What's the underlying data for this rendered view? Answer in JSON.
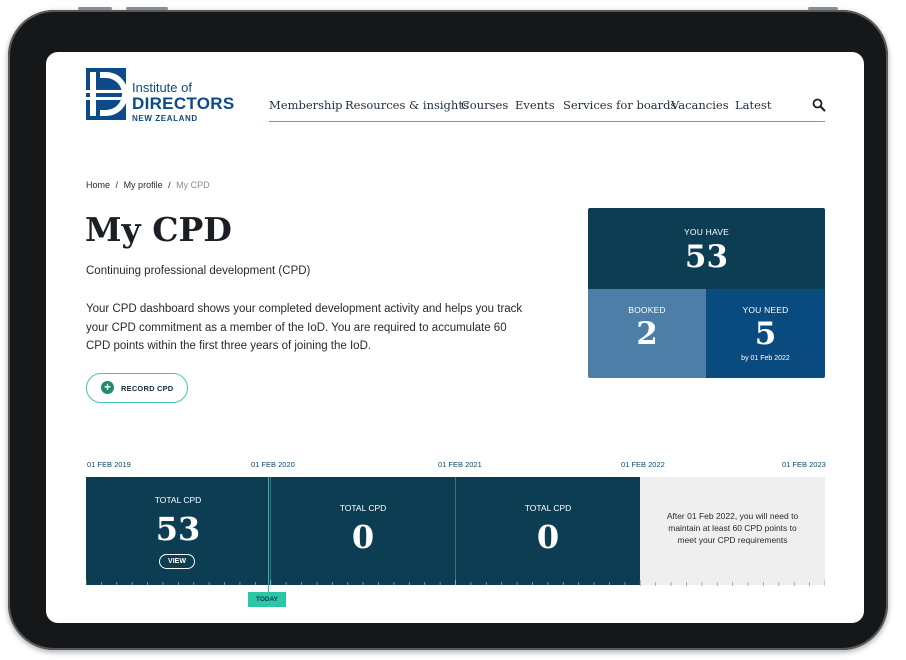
{
  "logo": {
    "line1": "Institute of",
    "line2": "DIRECTORS",
    "line3": "NEW ZEALAND"
  },
  "nav": {
    "items": [
      {
        "label": "Membership"
      },
      {
        "label": "Resources & insights"
      },
      {
        "label": "Courses"
      },
      {
        "label": "Events"
      },
      {
        "label": "Services for boards"
      },
      {
        "label": "Vacancies"
      },
      {
        "label": "Latest"
      }
    ],
    "search_icon": "search-icon"
  },
  "breadcrumb": {
    "items": [
      "Home",
      "My profile",
      "My CPD"
    ],
    "separator": "/"
  },
  "page": {
    "title": "My CPD",
    "subtitle": "Continuing professional development (CPD)",
    "description": "Your CPD dashboard shows your completed development activity and helps you track your CPD commitment as a member of the IoD. You are required to accumulate 60 CPD points within the first three years of joining the IoD.",
    "record_button": "RECORD CPD"
  },
  "stats": {
    "have_label": "YOU HAVE",
    "have_value": "53",
    "booked_label": "BOOKED",
    "booked_value": "2",
    "need_label": "YOU NEED",
    "need_value": "5",
    "need_note": "by 01 Feb 2022"
  },
  "timeline": {
    "dates": [
      "01 FEB 2019",
      "01 FEB 2020",
      "01 FEB 2021",
      "01 FEB 2022",
      "01 FEB 2023"
    ],
    "years": [
      {
        "label": "TOTAL CPD",
        "value": "53",
        "view": "VIEW"
      },
      {
        "label": "TOTAL CPD",
        "value": "0"
      },
      {
        "label": "TOTAL CPD",
        "value": "0"
      }
    ],
    "future_note": "After 01 Feb 2022, you will need to maintain at least 60 CPD points to meet your CPD requirements",
    "today_label": "TODAY"
  },
  "colors": {
    "brand_blue": "#0c4a8a",
    "dark_teal": "#0d3d52",
    "booked_blue": "#4d7ea7",
    "need_blue": "#0a4b7f",
    "accent_teal": "#2ac6a6",
    "nav_underline": "#e66a8a"
  }
}
